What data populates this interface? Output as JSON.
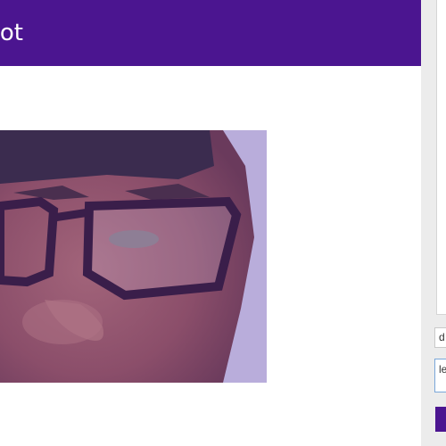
{
  "header": {
    "title": "Bot"
  },
  "webcam": {
    "description": ""
  },
  "chat": {
    "input_1_value": "d",
    "input_2_value": "le"
  },
  "colors": {
    "header": "#4b1590",
    "panel": "#ececec",
    "accent": "#4b1590"
  }
}
